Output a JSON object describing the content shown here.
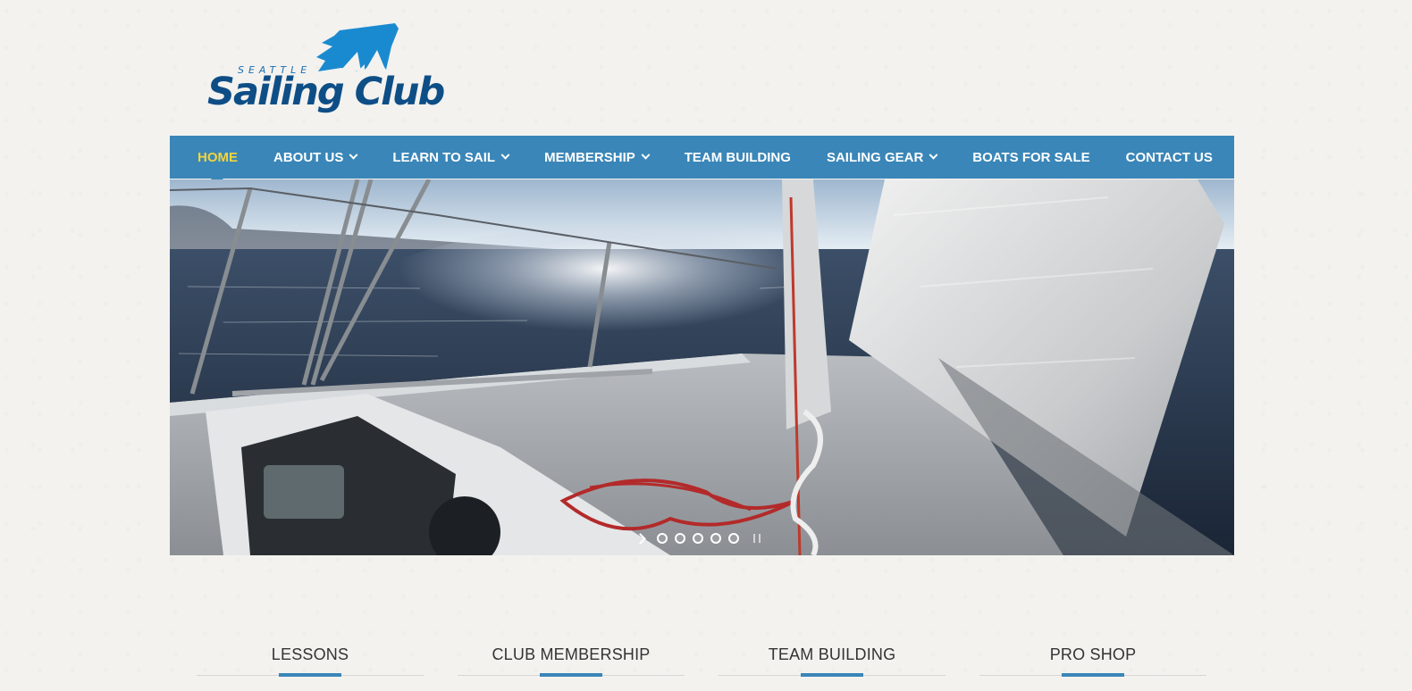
{
  "brand": {
    "city": "SEATTLE",
    "name": "Sailing Club",
    "logo_icon": "sail-brush-icon",
    "colors": {
      "primary": "#0e4e86",
      "accent": "#1a6fb0"
    }
  },
  "nav": {
    "background": "#3a86b8",
    "active_color": "#f2d53c",
    "items": [
      {
        "label": "HOME",
        "active": true,
        "dropdown": false
      },
      {
        "label": "ABOUT US",
        "active": false,
        "dropdown": true
      },
      {
        "label": "LEARN TO SAIL",
        "active": false,
        "dropdown": true
      },
      {
        "label": "MEMBERSHIP",
        "active": false,
        "dropdown": true
      },
      {
        "label": "TEAM BUILDING",
        "active": false,
        "dropdown": false
      },
      {
        "label": "SAILING GEAR",
        "active": false,
        "dropdown": true
      },
      {
        "label": "BOATS FOR SALE",
        "active": false,
        "dropdown": false
      },
      {
        "label": "CONTACT US",
        "active": false,
        "dropdown": false
      }
    ]
  },
  "slider": {
    "image": "sailboat-deck-photo",
    "slide_count": 5,
    "controls": {
      "next_icon": "chevron-right-icon",
      "pause_icon": "pause-icon"
    }
  },
  "features": [
    {
      "title": "LESSONS"
    },
    {
      "title": "CLUB MEMBERSHIP"
    },
    {
      "title": "TEAM BUILDING"
    },
    {
      "title": "PRO SHOP"
    }
  ]
}
